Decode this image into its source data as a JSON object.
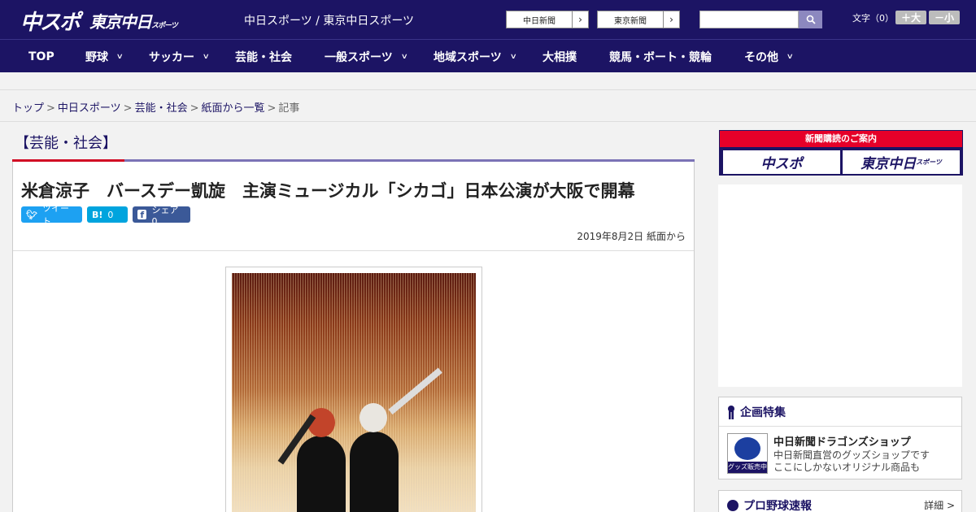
{
  "header": {
    "logo_main": "中スポ",
    "logo_tokyo": "東京中日",
    "logo_tokyo_sub": "スポーツ",
    "site_names": "中日スポーツ / 東京中日スポーツ",
    "link_chunichi": "中日新聞",
    "link_tokyo": "東京新聞",
    "search_placeholder": "",
    "font_size_label": "文字（0）",
    "font_up": "＋大",
    "font_down": "－小"
  },
  "nav": {
    "items": [
      {
        "label": "TOP",
        "has_menu": false
      },
      {
        "label": "野球",
        "has_menu": true
      },
      {
        "label": "サッカー",
        "has_menu": true
      },
      {
        "label": "芸能・社会",
        "has_menu": false
      },
      {
        "label": "一般スポーツ",
        "has_menu": true
      },
      {
        "label": "地域スポーツ",
        "has_menu": true
      },
      {
        "label": "大相撲",
        "has_menu": false
      },
      {
        "label": "競馬・ボート・競輪",
        "has_menu": false
      },
      {
        "label": "その他",
        "has_menu": true
      }
    ]
  },
  "breadcrumb": {
    "items": [
      "トップ",
      "中日スポーツ",
      "芸能・社会",
      "紙面から一覧"
    ],
    "current": "記事",
    "separator": ">"
  },
  "article": {
    "category": "【芸能・社会】",
    "headline": "米倉涼子　バースデー凱旋　主演ミュージカル「シカゴ」日本公演が大阪で開幕",
    "share": {
      "tweet_label": "ツイート",
      "hatena_count": "0",
      "facebook_label": "シェア 0"
    },
    "date": "2019年8月2日 紙面から"
  },
  "sidebar": {
    "subscription_title": "新聞購読のご案内",
    "sub_btn_1": "中スポ",
    "sub_btn_2": "東京中日",
    "sub_btn_2_sub": "スポーツ",
    "feature_title": "企画特集",
    "feature_item_title": "中日新聞ドラゴンズショップ",
    "feature_item_desc1": "中日新聞直営のグッズショップです",
    "feature_item_desc2": "ここにしかないオリジナル商品も",
    "feature_thumb_label": "グッズ販売中",
    "baseball_title": "プロ野球速報",
    "details_label": "詳細 >"
  },
  "colors": {
    "brand": "#1c1464",
    "accent_red": "#d10a24",
    "twitter": "#1da1f2",
    "hatena": "#00a4de",
    "facebook": "#3b5998"
  }
}
